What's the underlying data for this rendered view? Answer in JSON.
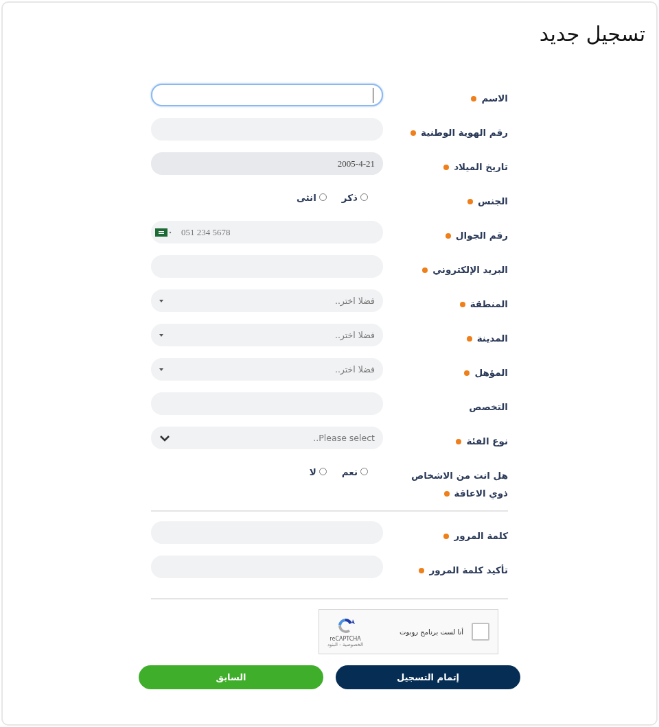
{
  "title": "تسجيل جديد",
  "sections": [
    {
      "fields": [
        {
          "label": "الاسم",
          "required": true,
          "kind": "text",
          "focused": true
        },
        {
          "label": "رقم الهوية الوطنية",
          "required": true,
          "kind": "text",
          "focused": false
        },
        {
          "label": "تاريخ الميلاد",
          "required": true,
          "kind": "date",
          "value": "2005-4-21"
        },
        {
          "label": "الجنس",
          "required": true,
          "kind": "radio",
          "options": [
            {
              "label": "ذكر",
              "selected": false
            },
            {
              "label": "انثى",
              "selected": false
            }
          ]
        },
        {
          "label": "رقم الجوال",
          "required": true,
          "kind": "phone",
          "placeholder": "051 234 5678"
        },
        {
          "label": "البريد الإلكتروني",
          "required": true,
          "kind": "text",
          "focused": false
        },
        {
          "label": "المنطقة",
          "required": true,
          "kind": "select",
          "placeholder": "فضلا اختر.."
        },
        {
          "label": "المدينة",
          "required": true,
          "kind": "select",
          "placeholder": "فضلا اختر.."
        },
        {
          "label": "المؤهل",
          "required": true,
          "kind": "select",
          "placeholder": "فضلا اختر.."
        },
        {
          "label": "التخصص",
          "required": false,
          "kind": "text",
          "focused": false
        },
        {
          "label": "نوع الفئة",
          "required": true,
          "kind": "dropdown",
          "placeholder": "Please select.."
        },
        {
          "label": "هل انت من الاشخاص ذوي الاعاقة",
          "required": true,
          "kind": "radio",
          "options": [
            {
              "label": "نعم",
              "selected": false
            },
            {
              "label": "لا",
              "selected": false
            }
          ]
        }
      ]
    },
    {
      "fields": [
        {
          "label": "كلمة المرور",
          "required": true,
          "kind": "text",
          "focused": false
        },
        {
          "label": "تأكيد كلمة المرور",
          "required": true,
          "kind": "text",
          "focused": false
        }
      ]
    }
  ],
  "captcha": {
    "label": "أنا لست برنامج روبوت",
    "checked": false,
    "brand": "reCAPTCHA",
    "links": "الخصوصية - البنود"
  },
  "buttons": [
    {
      "label": "إتمام التسجيل",
      "kind": "primary"
    },
    {
      "label": "السابق",
      "kind": "secondary"
    }
  ]
}
